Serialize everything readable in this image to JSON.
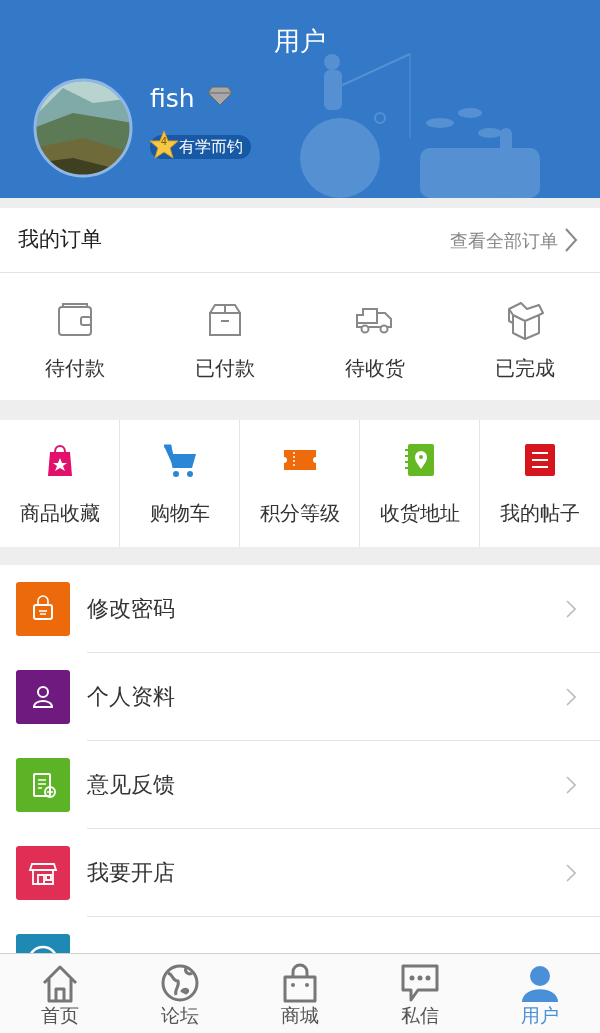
{
  "header": {
    "title": "用户",
    "username": "fish",
    "level_badge": {
      "level": "4",
      "label": "有学而钓"
    }
  },
  "orders": {
    "title": "我的订单",
    "view_all": "查看全部订单",
    "statuses": [
      {
        "kind": "wallet",
        "label": "待付款"
      },
      {
        "kind": "box",
        "label": "已付款"
      },
      {
        "kind": "truck",
        "label": "待收货"
      },
      {
        "kind": "openbox",
        "label": "已完成"
      }
    ]
  },
  "shortcuts": [
    {
      "kind": "bag",
      "label": "商品收藏",
      "color": "#e0106b"
    },
    {
      "kind": "cart",
      "label": "购物车",
      "color": "#2a86d6"
    },
    {
      "kind": "ticket",
      "label": "积分等级",
      "color": "#ee6a0b"
    },
    {
      "kind": "address",
      "label": "收货地址",
      "color": "#64b822"
    },
    {
      "kind": "list",
      "label": "我的帖子",
      "color": "#d7151c"
    }
  ],
  "menu": [
    {
      "kind": "lock",
      "label": "修改密码",
      "color": "#ec6a0c"
    },
    {
      "kind": "person",
      "label": "个人资料",
      "color": "#6e1a7e"
    },
    {
      "kind": "feedback",
      "label": "意见反馈",
      "color": "#5db326"
    },
    {
      "kind": "shop",
      "label": "我要开店",
      "color": "#e02e55"
    },
    {
      "kind": "info",
      "color": "#1e8ab4"
    }
  ],
  "tabs": [
    {
      "kind": "home",
      "label": "首页",
      "selected": false
    },
    {
      "kind": "globe",
      "label": "论坛",
      "selected": false
    },
    {
      "kind": "bag",
      "label": "商城",
      "selected": false
    },
    {
      "kind": "chat",
      "label": "私信",
      "selected": false
    },
    {
      "kind": "user",
      "label": "用户",
      "selected": true
    }
  ]
}
